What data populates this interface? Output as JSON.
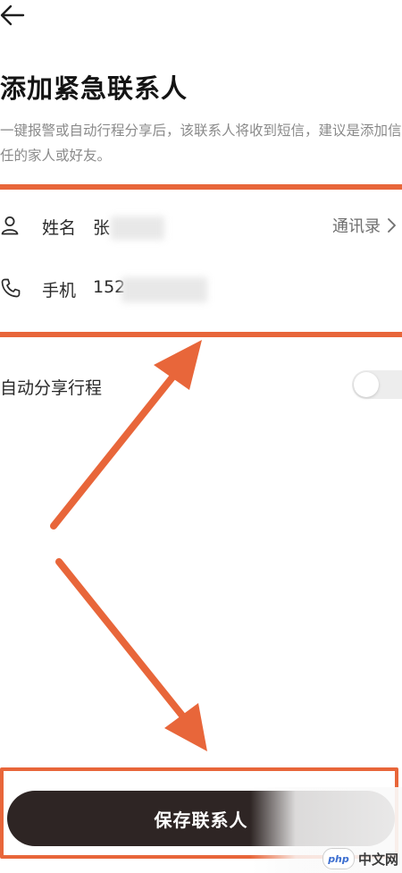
{
  "colors": {
    "highlight": "#e8663a",
    "primary_button": "#2e2524",
    "muted_text": "#8a8a8a"
  },
  "header": {
    "back_icon": "arrow-left-icon"
  },
  "page": {
    "title": "添加紧急联系人",
    "description": "一键报警或自动行程分享后，该联系人将收到短信，建议是添加信任的家人或好友。"
  },
  "form": {
    "name": {
      "icon": "user-icon",
      "label": "姓名",
      "value": "张"
    },
    "phone": {
      "icon": "phone-icon",
      "label": "手机",
      "value": "152"
    },
    "contacts_link": {
      "label": "通讯录",
      "icon": "chevron-right-icon"
    }
  },
  "share": {
    "label": "自动分享行程",
    "enabled": false
  },
  "actions": {
    "save_label": "保存联系人"
  },
  "watermark": {
    "badge": "php",
    "text": "中文网"
  }
}
